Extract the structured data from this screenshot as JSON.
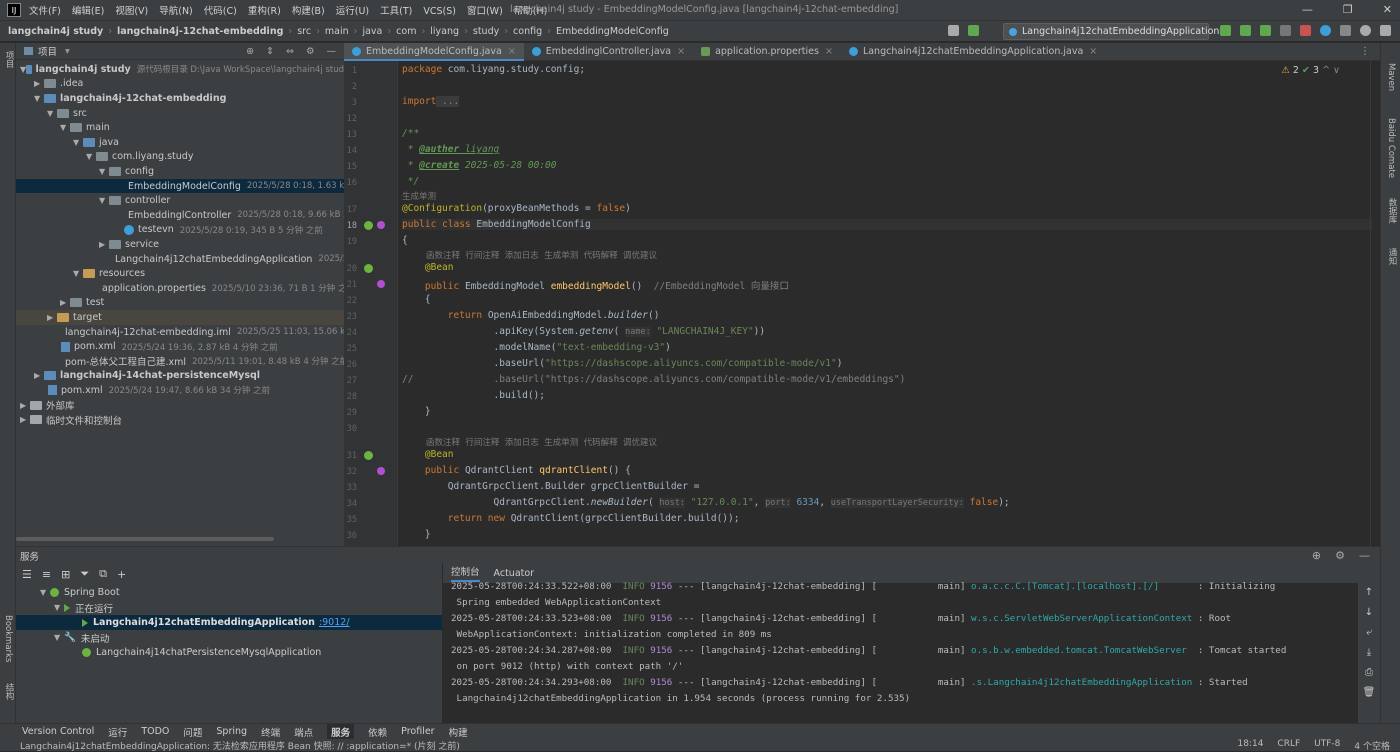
{
  "titlebar": {
    "menus": [
      "文件(F)",
      "编辑(E)",
      "视图(V)",
      "导航(N)",
      "代码(C)",
      "重构(R)",
      "构建(B)",
      "运行(U)",
      "工具(T)",
      "VCS(S)",
      "窗口(W)",
      "帮助(H)"
    ],
    "title": "langchain4j study - EmbeddingModelConfig.java [langchain4j-12chat-embedding]"
  },
  "breadcrumb": [
    "langchain4j study",
    "langchain4j-12chat-embedding",
    "src",
    "main",
    "java",
    "com",
    "liyang",
    "study",
    "config",
    "EmbeddingModelConfig"
  ],
  "run_config": "Langchain4j12chatEmbeddingApplication",
  "project": {
    "header": "项目",
    "rows": [
      {
        "name": "langchain4j study",
        "meta": "源代码根目录  D:\\Java WorkSpace\\langchain4j stud"
      },
      {
        "name": ".idea"
      },
      {
        "name": "langchain4j-12chat-embedding"
      },
      {
        "name": "src"
      },
      {
        "name": "main"
      },
      {
        "name": "java"
      },
      {
        "name": "com.liyang.study"
      },
      {
        "name": "config"
      },
      {
        "name": "EmbeddingModelConfig",
        "meta": "2025/5/28 0:18, 1.63 kB 2"
      },
      {
        "name": "controller"
      },
      {
        "name": "EmbeddinglController",
        "meta": "2025/5/28 0:18, 9.66 kB 2"
      },
      {
        "name": "testevn",
        "meta": "2025/5/28 0:19, 345 B 5 分钟 之前"
      },
      {
        "name": "service"
      },
      {
        "name": "Langchain4j12chatEmbeddingApplication",
        "meta": "2025/5/28"
      },
      {
        "name": "resources"
      },
      {
        "name": "application.properties",
        "meta": "2025/5/10 23:36, 71 B 1 分钟 之前"
      },
      {
        "name": "test"
      },
      {
        "name": "target"
      },
      {
        "name": "langchain4j-12chat-embedding.iml",
        "meta": "2025/5/25 11:03, 15.06 kB"
      },
      {
        "name": "pom.xml",
        "meta": "2025/5/24 19:36, 2.87 kB 4 分钟 之前"
      },
      {
        "name": "pom-总体父工程自己建.xml",
        "meta": "2025/5/11 19:01, 8.48 kB 4 分钟 之前"
      },
      {
        "name": "langchain4j-14chat-persistenceMysql"
      },
      {
        "name": "pom.xml",
        "meta": "2025/5/24 19:47, 8.66 kB 34 分钟 之前"
      },
      {
        "name": "外部库"
      },
      {
        "name": "临时文件和控制台"
      }
    ]
  },
  "tabs": [
    "EmbeddingModelConfig.java",
    "EmbeddinglController.java",
    "application.properties",
    "Langchain4j12chatEmbeddingApplication.java"
  ],
  "inspections": {
    "warnings": "2",
    "ok": "3"
  },
  "code": {
    "line_numbers": [
      "1",
      "2",
      "3",
      "12",
      "13",
      "14",
      "15",
      "16",
      "17",
      "18",
      "19",
      "20",
      "21",
      "22",
      "23",
      "24",
      "25",
      "26",
      "27",
      "28",
      "29",
      "30",
      "31",
      "32",
      "33",
      "34",
      "35",
      "36"
    ],
    "package_kw": "package",
    "package_name": " com.liyang.study.config;",
    "import_kw": "import",
    "import_fold": " ...",
    "doc_open": "/**",
    "doc_author_tag": "@auther",
    "doc_author": " liyang",
    "doc_create_tag": "@create",
    "doc_create": " 2025-05-28 00:00",
    "doc_close": " */",
    "hint_gen": "生成单测",
    "config_ann": "@Configuration",
    "config_args": "(proxyBeanMethods = ",
    "false_kw": "false",
    "close_paren": ")",
    "public_class_kw": "public class ",
    "class_name": "EmbeddingModelConfig",
    "open_brace": "{",
    "hint_methods": "函数注释  行间注释  添加日志  生成单测  代码解释  调优建议",
    "bean_ann": "@Bean",
    "m1_sig_kw": "public ",
    "m1_type": "EmbeddingModel ",
    "m1_name": "embeddingModel",
    "m1_paren": "()",
    "m1_comment": "  //EmbeddingModel 向量接口",
    "inner_open": "    {",
    "return_kw": "return ",
    "builder_call": "OpenAiEmbeddingModel.",
    "builder_fn": "builder",
    "builder_end": "()",
    "apikey_a": ".apiKey(System.",
    "apikey_fn": "getenv",
    "apikey_b": "(",
    "apikey_ph": "name:",
    "apikey_str": "\"LANGCHAIN4J_KEY\"",
    "apikey_c": "))",
    "model_a": ".modelName(",
    "model_str": "\"text-embedding-v3\"",
    "model_c": ")",
    "base_a": ".baseUrl(",
    "base_url": "\"https://dashscope.aliyuncs.com/compatible-mode/v1\"",
    "base_c": ")",
    "cbase_prefix": "//",
    "cbase_a": ".baseUrl(",
    "cbase_url": "\"https://dashscope.aliyuncs.com/compatible-mode/v1/embeddings\"",
    "cbase_c": ")",
    "build_call": ".build();",
    "inner_close": "    }",
    "m2_sig_kw": "public ",
    "m2_type": "QdrantClient ",
    "m2_name": "qdrantClient",
    "m2_paren": "() {",
    "q1": "QdrantGrpcClient.Builder grpcClientBuilder =",
    "q2_a": "QdrantGrpcClient.",
    "q2_fn": "newBuilder",
    "q2_b": "(",
    "q2_ph1": "host:",
    "q2_s1": "\"127.0.0.1\"",
    "q2_c": ", ",
    "q2_ph2": "port:",
    "q2_n": "6334",
    "q2_d": ", ",
    "q2_ph3": "useTransportLayerSecurity:",
    "q2_f": "false",
    "q2_e": ");",
    "q3_kw": "return new ",
    "q3": "QdrantClient(grpcClientBuilder.build());",
    "q4": "    }"
  },
  "services": {
    "header": "服务",
    "spring_boot": "Spring Boot",
    "running": "正在运行",
    "app1": "Langchain4j12chatEmbeddingApplication",
    "app1_port": ":9012/",
    "not_started": "未启动",
    "app2": "Langchain4j14chatPersistenceMysqlApplication"
  },
  "console": {
    "tabs": [
      "控制台",
      "Actuator"
    ],
    "lines": [
      {
        "ts": "2025-05-28T00:24:33.522+08:00",
        "lvl": "INFO",
        "pid": "9156",
        "mid": "--- [langchain4j-12chat-embedding] [           main] ",
        "logger": "o.a.c.c.C.[Tomcat].[localhost].[/]      ",
        "msg": " : Initializing"
      },
      {
        "cont": " Spring embedded WebApplicationContext"
      },
      {
        "ts": "2025-05-28T00:24:33.523+08:00",
        "lvl": "INFO",
        "pid": "9156",
        "mid": "--- [langchain4j-12chat-embedding] [           main] ",
        "logger": "w.s.c.ServletWebServerApplicationContext",
        "msg": " : Root"
      },
      {
        "cont": " WebApplicationContext: initialization completed in 809 ms"
      },
      {
        "ts": "2025-05-28T00:24:34.287+08:00",
        "lvl": "INFO",
        "pid": "9156",
        "mid": "--- [langchain4j-12chat-embedding] [           main] ",
        "logger": "o.s.b.w.embedded.tomcat.TomcatWebServer ",
        "msg": " : Tomcat started"
      },
      {
        "cont": " on port 9012 (http) with context path '/'"
      },
      {
        "ts": "2025-05-28T00:24:34.293+08:00",
        "lvl": "INFO",
        "pid": "9156",
        "mid": "--- [langchain4j-12chat-embedding] [           main] ",
        "logger": ".s.Langchain4j12chatEmbeddingApplication",
        "msg": " : Started"
      },
      {
        "cont": " Langchain4j12chatEmbeddingApplication in 1.954 seconds (process running for 2.535)"
      }
    ]
  },
  "bottom_tools": [
    "Version Control",
    "运行",
    "TODO",
    "问题",
    "Spring",
    "终端",
    "端点",
    "服务",
    "依赖",
    "Profiler",
    "构建"
  ],
  "status": {
    "message": "Langchain4j12chatEmbeddingApplication: 无法检索应用程序 Bean 快照: // :application=* (片刻 之前)",
    "position": "18:14",
    "line_sep": "CRLF",
    "encoding": "UTF-8",
    "indent": "4 个空格"
  },
  "side_labels": {
    "left1": "项目",
    "left2": "Bookmarks",
    "left3": "结构",
    "right1": "Maven",
    "right2": "Baidu Comate",
    "right3": "数据库",
    "right4": "通知"
  }
}
